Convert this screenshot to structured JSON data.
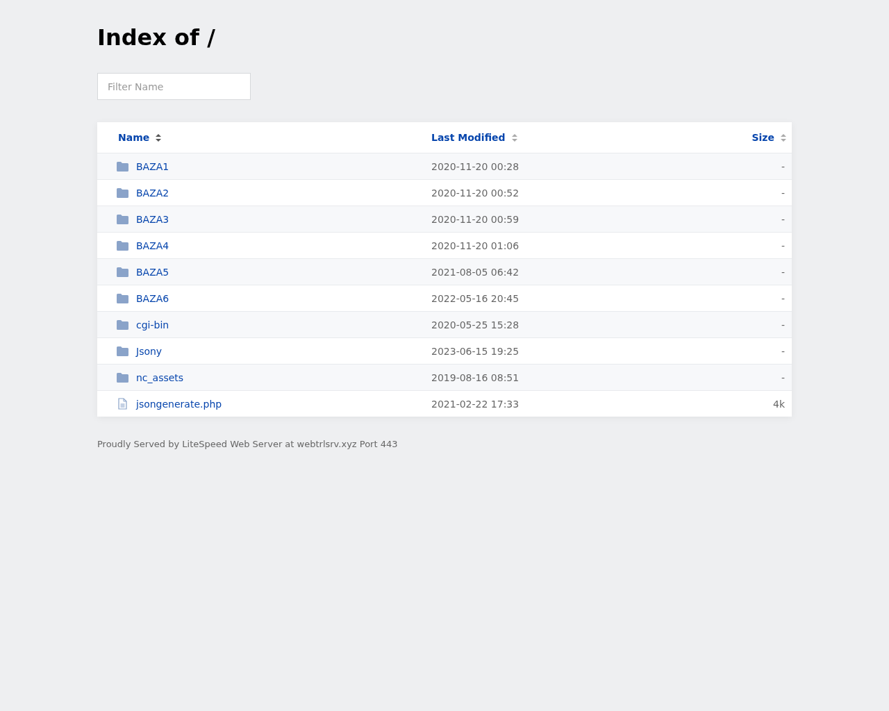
{
  "title": "Index of /",
  "filter": {
    "placeholder": "Filter Name"
  },
  "columns": [
    {
      "label": "Name",
      "selected": true
    },
    {
      "label": "Last Modified",
      "selected": false
    },
    {
      "label": "Size",
      "selected": false
    }
  ],
  "rows": [
    {
      "kind": "folder",
      "name": "BAZA1",
      "modified": "2020-11-20 00:28",
      "size": "-"
    },
    {
      "kind": "folder",
      "name": "BAZA2",
      "modified": "2020-11-20 00:52",
      "size": "-"
    },
    {
      "kind": "folder",
      "name": "BAZA3",
      "modified": "2020-11-20 00:59",
      "size": "-"
    },
    {
      "kind": "folder",
      "name": "BAZA4",
      "modified": "2020-11-20 01:06",
      "size": "-"
    },
    {
      "kind": "folder",
      "name": "BAZA5",
      "modified": "2021-08-05 06:42",
      "size": "-"
    },
    {
      "kind": "folder",
      "name": "BAZA6",
      "modified": "2022-05-16 20:45",
      "size": "-"
    },
    {
      "kind": "folder",
      "name": "cgi-bin",
      "modified": "2020-05-25 15:28",
      "size": "-"
    },
    {
      "kind": "folder",
      "name": "Jsony",
      "modified": "2023-06-15 19:25",
      "size": "-"
    },
    {
      "kind": "folder",
      "name": "nc_assets",
      "modified": "2019-08-16 08:51",
      "size": "-"
    },
    {
      "kind": "file",
      "name": "jsongenerate.php",
      "modified": "2021-02-22 17:33",
      "size": "4k"
    }
  ],
  "footer": "Proudly Served by LiteSpeed Web Server at webtrlsrv.xyz Port 443"
}
